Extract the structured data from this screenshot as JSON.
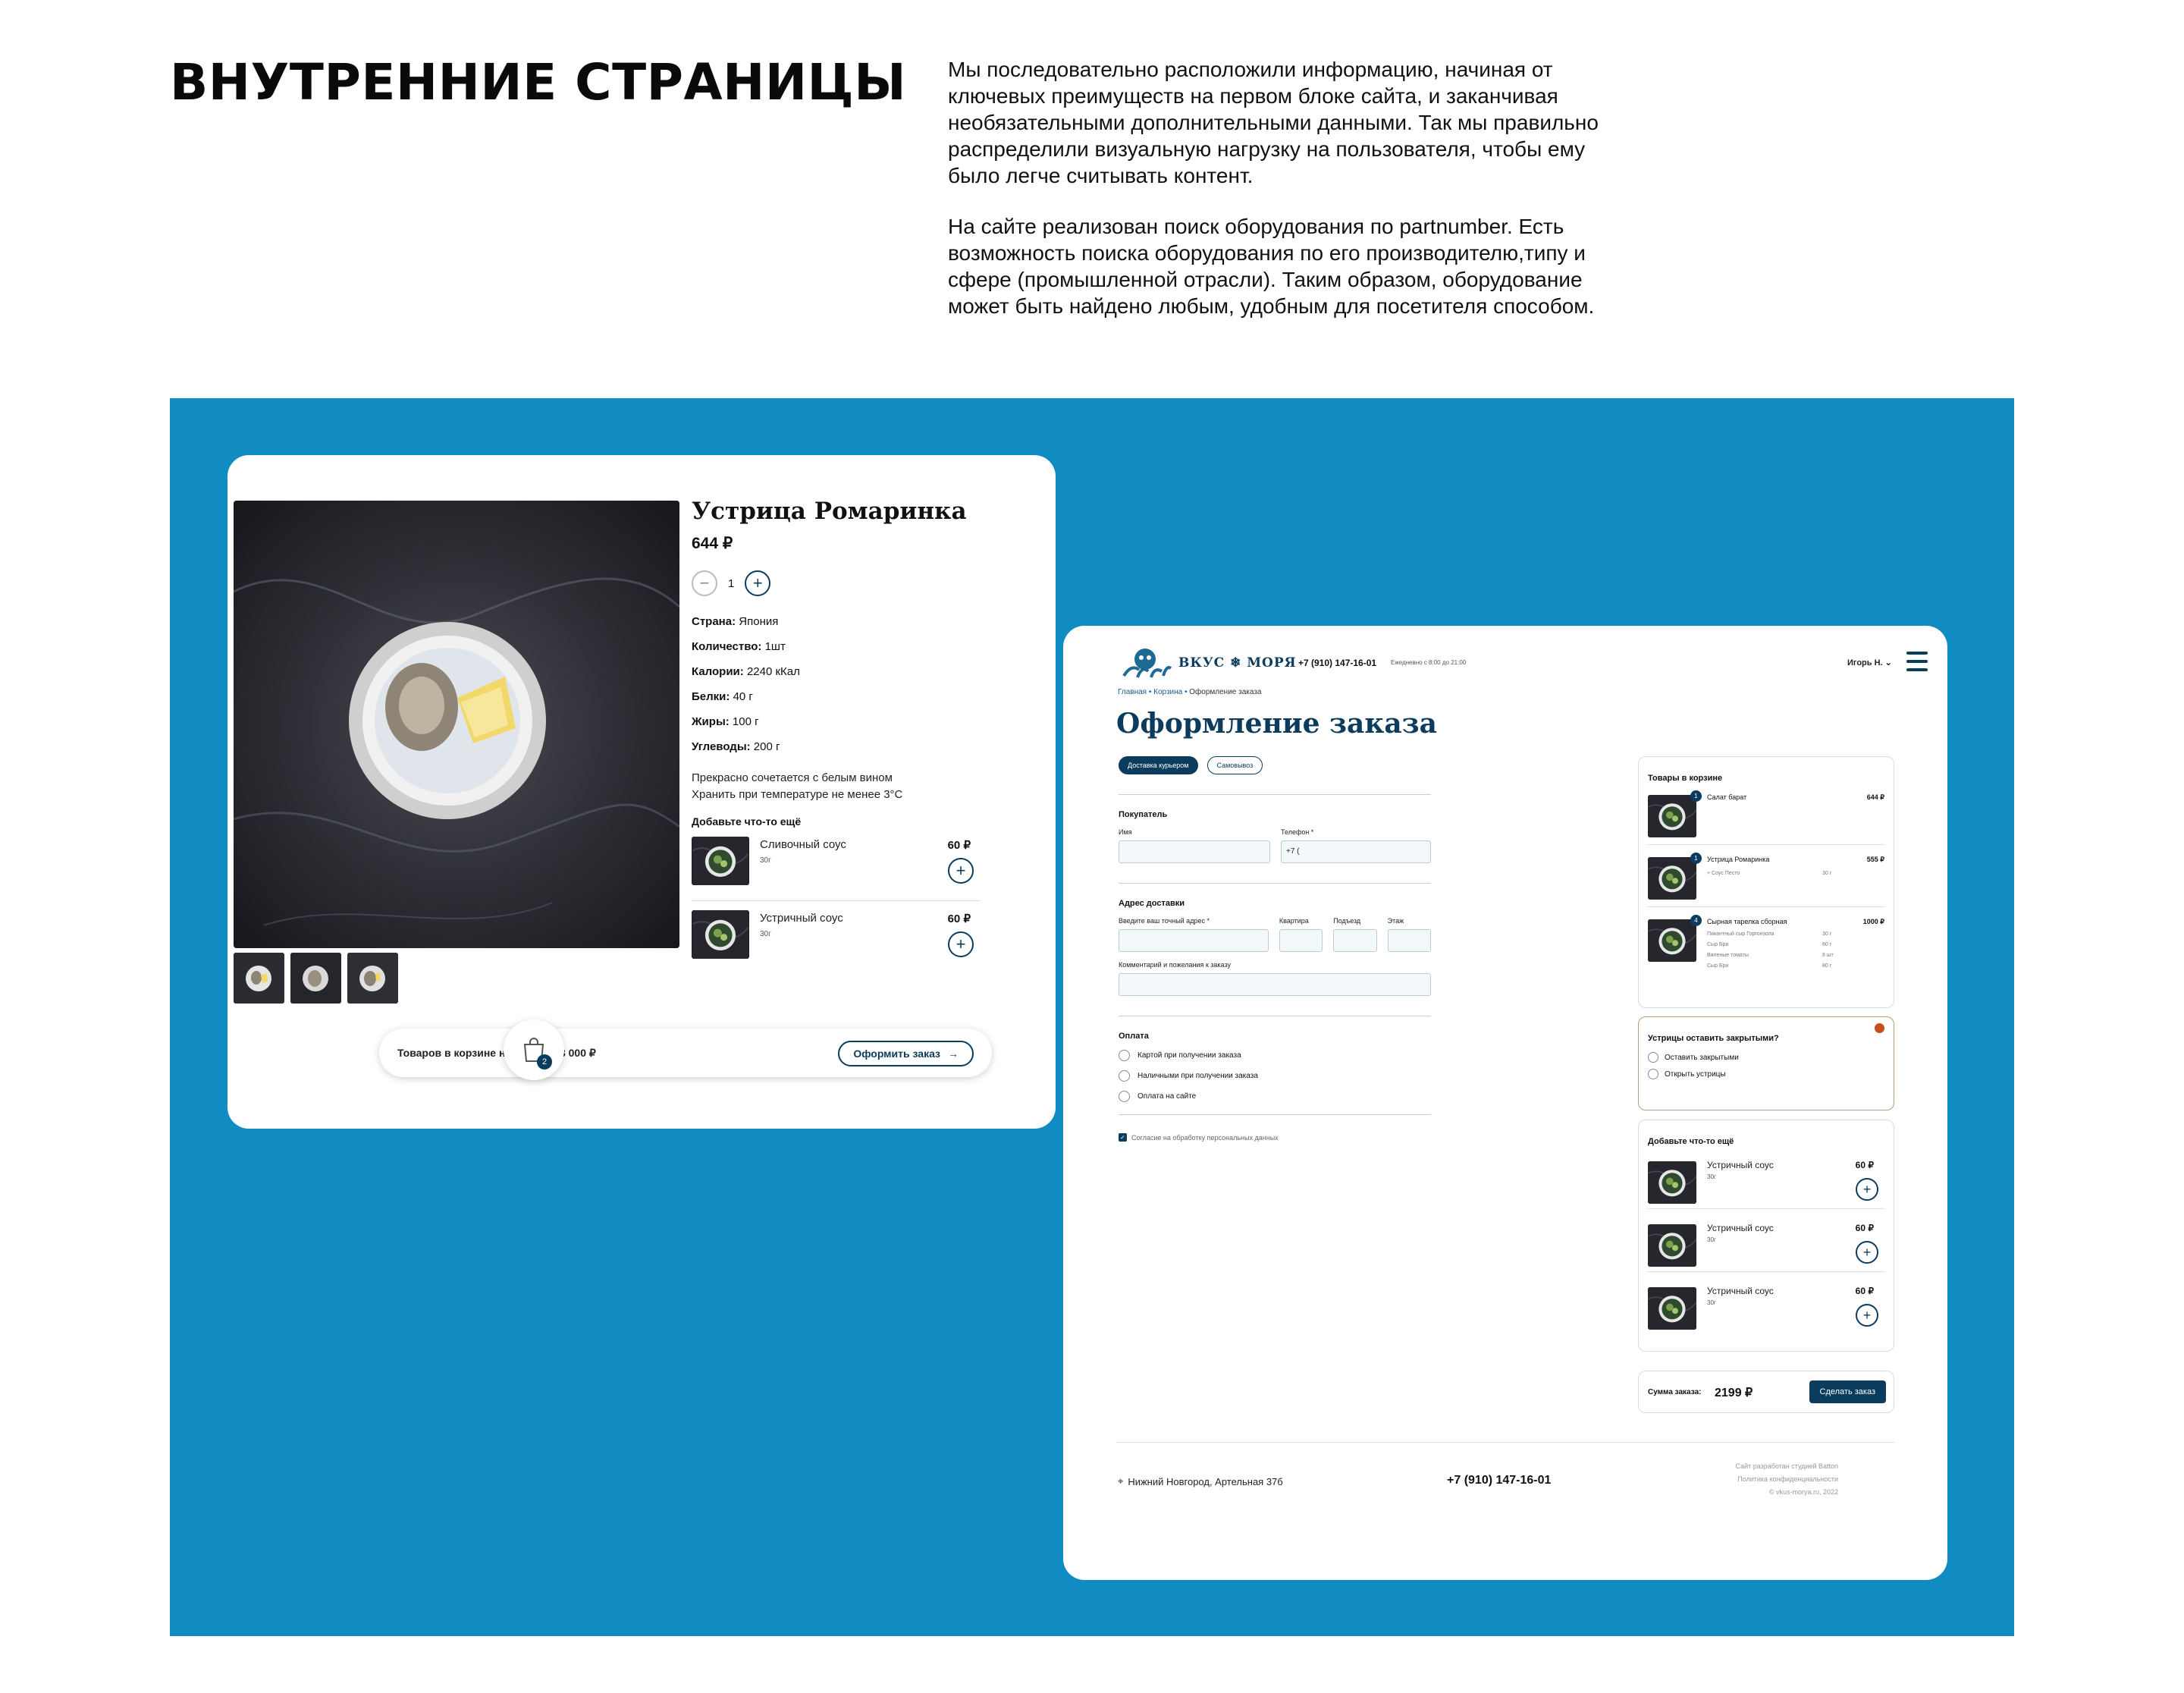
{
  "heading": "ВНУТРЕННИЕ СТРАНИЦЫ",
  "intro": {
    "paragraph1": "Мы последовательно расположили информацию, начиная от ключевых преимуществ на первом блоке сайта, и заканчивая необязательными дополнительными данными. Так мы правильно распределили визуальную нагрузку на пользователя, чтобы ему было легче считывать контент.",
    "paragraph2": "На сайте реализован поиск оборудования по partnumber. Есть возможность поиска оборудования по его производителю,типу и сфере (промышленной отрасли). Таким образом, оборудование может быть найдено любым, удобным для посетителя способом."
  },
  "colors": {
    "background_blue": "#118cc3",
    "brand_navy": "#0b3c5d"
  },
  "product": {
    "title": "Устрица Ромаринка",
    "price": "644 ₽",
    "quantity": "1",
    "specs": [
      {
        "label": "Страна:",
        "value": "Япония"
      },
      {
        "label": "Количество:",
        "value": "1шт"
      },
      {
        "label": "Калории:",
        "value": "2240 кКал"
      },
      {
        "label": "Белки:",
        "value": "40 г"
      },
      {
        "label": "Жиры:",
        "value": "100 г"
      },
      {
        "label": "Углеводы:",
        "value": "200 г"
      }
    ],
    "desc1": "Прекрасно сочетается с белым вином",
    "desc2": "Хранить при температуре не менее 3°С",
    "add_more_title": "Добавьте что-то ещё",
    "add_more": [
      {
        "name": "Сливочный соус",
        "weight": "30г",
        "price": "60 ₽"
      },
      {
        "name": "Устричный соус",
        "weight": "30г",
        "price": "60 ₽"
      }
    ],
    "cart_text": "Товаров в корзине на сумму: 23 000 ₽",
    "cart_badge": "2",
    "checkout_button": "Оформить заказ"
  },
  "checkout": {
    "logo": "ВКУС ❄ МОРЯ",
    "phone": "+7 (910) 147-16-01",
    "hours": "Ежедневно с 8:00 до 21:00",
    "user": "Игорь Н. ⌄",
    "breadcrumbs": {
      "home": "Главная",
      "cart": "Корзина",
      "current": "Оформление заказа",
      "sep": " • "
    },
    "title": "Оформление заказа",
    "delivery_tabs": {
      "courier": "Доставка курьером",
      "pickup": "Самовывоз"
    },
    "buyer_section": "Покупатель",
    "name_label": "Имя",
    "phone_label": "Телефон *",
    "phone_value": "+7 (",
    "address_section": "Адрес доставки",
    "address_label": "Введите ваш точный адрес *",
    "apt_label": "Квартира",
    "entrance_label": "Подъезд",
    "floor_label": "Этаж",
    "comment_label": "Комментарий и пожелания к заказу",
    "payment_section": "Оплата",
    "payment_options": [
      "Картой при получении заказа",
      "Наличными при получении заказа",
      "Оплата на сайте"
    ],
    "consent": "Согласие на обработку персональных данных",
    "cart_title": "Товары в корзине",
    "cart_items": [
      {
        "num": "1",
        "name": "Салат барат",
        "price": "644 ₽"
      },
      {
        "num": "1",
        "name": "Устрица Ромаринка",
        "price": "555 ₽",
        "extra": "+ Соус Песто",
        "extra_qty": "30 г"
      },
      {
        "num": "4",
        "name": "Сырная тарелка сборная",
        "price": "1000 ₽",
        "parts": [
          {
            "name": "Пикантный сыр Горгонзола",
            "qty": "30 г"
          },
          {
            "name": "Сыр Бри",
            "qty": "80 г"
          },
          {
            "name": "Вяленые томаты",
            "qty": "8 шт"
          },
          {
            "name": "Сыр Бри",
            "qty": "80 г"
          }
        ]
      }
    ],
    "oyster_question": "Устрицы оставить закрытыми?",
    "oyster_options": [
      "Оставить закрытыми",
      "Открыть устрицы"
    ],
    "add_more_title": "Добавьте что-то ещё",
    "add_more": [
      {
        "name": "Устричный соус",
        "weight": "30г",
        "price": "60 ₽"
      },
      {
        "name": "Устричный соус",
        "weight": "30г",
        "price": "60 ₽"
      },
      {
        "name": "Устричный соус",
        "weight": "30г",
        "price": "60 ₽"
      }
    ],
    "sum_label": "Сумма заказа:",
    "sum_value": "2199 ₽",
    "order_button": "Сделать заказ",
    "footer": {
      "address": "Нижний Новгород, Артельная 37б",
      "phone": "+7 (910) 147-16-01",
      "legal1": "Сайт разработан студией Batton",
      "legal2": "Политика конфиденциальности",
      "legal3": "© vkus-morya.ru, 2022"
    }
  }
}
